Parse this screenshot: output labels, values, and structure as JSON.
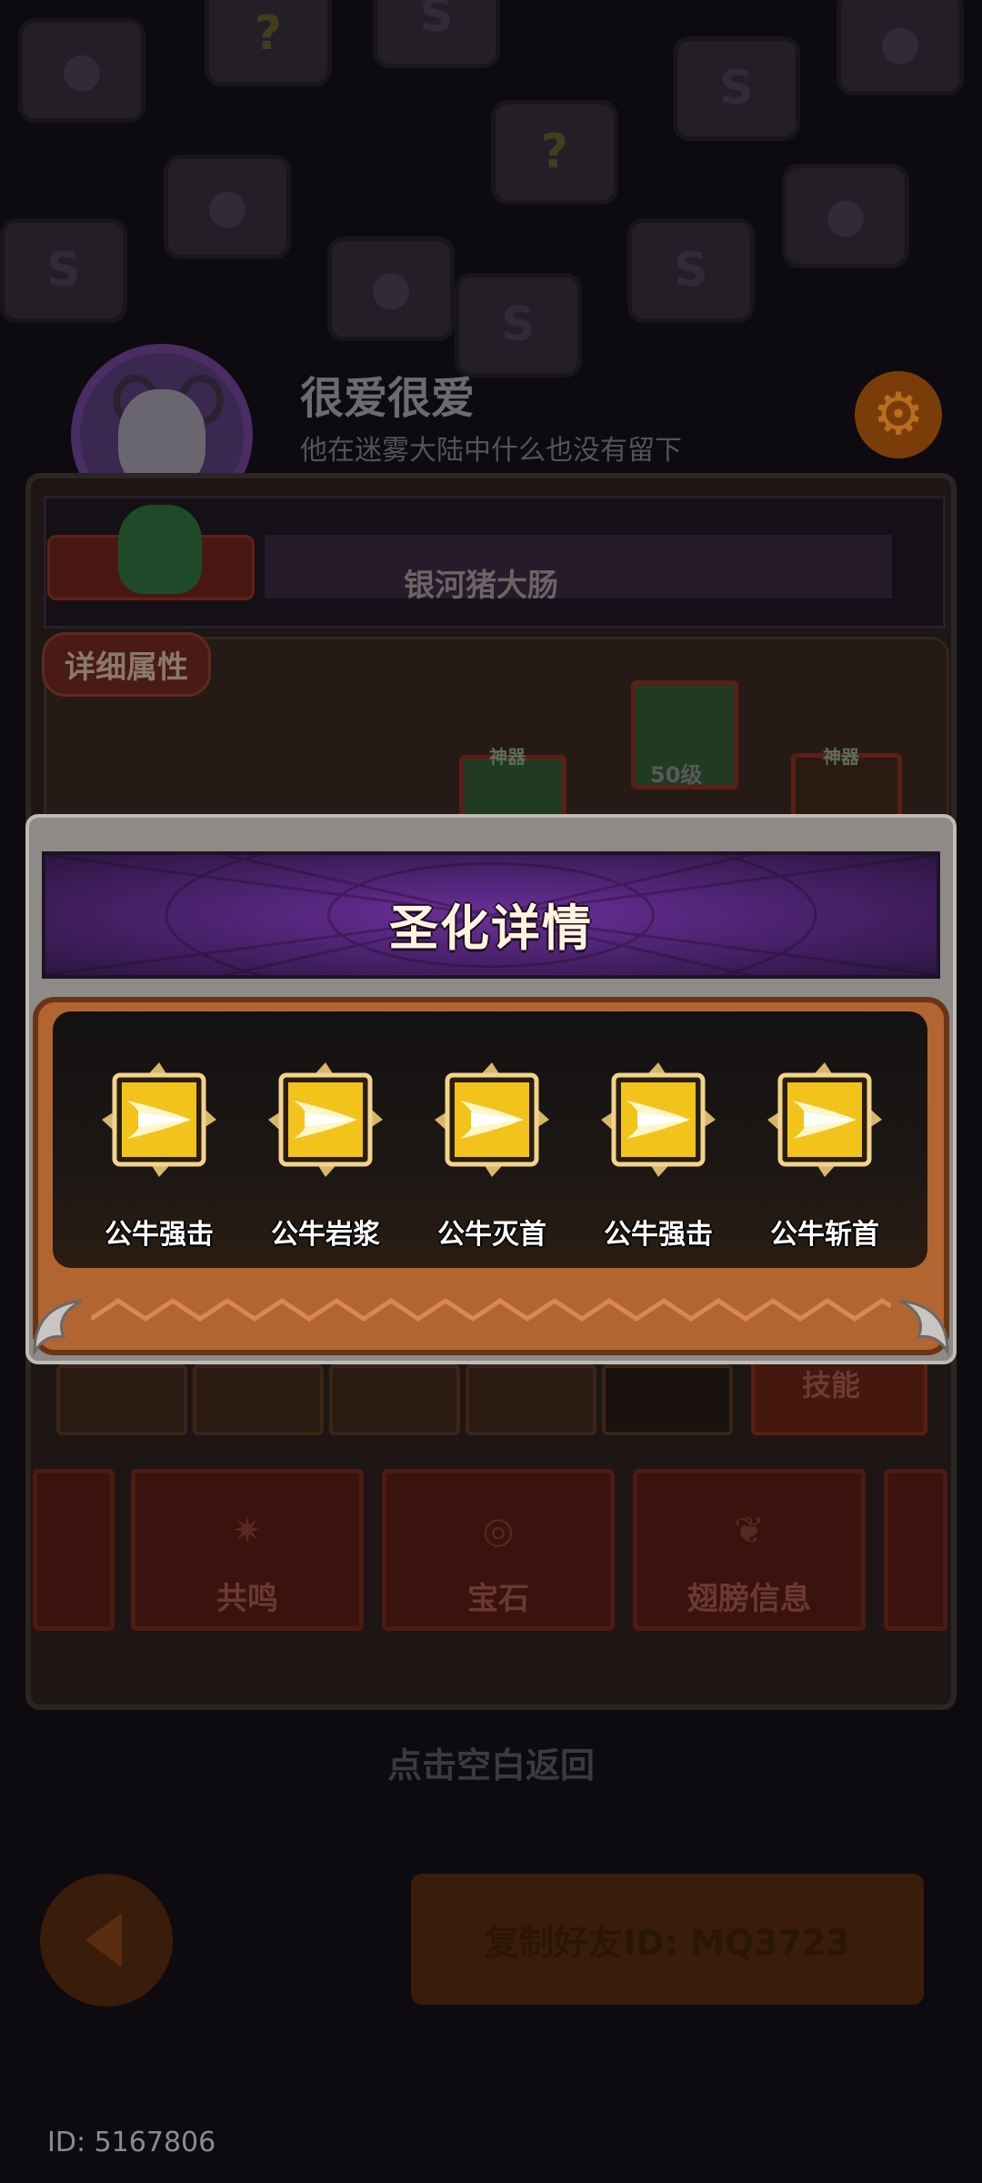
{
  "profile": {
    "name": "很爱很爱",
    "bio": "他在迷雾大陆中什么也没有留下"
  },
  "panel": {
    "title": "银河猪大肠",
    "attr_label": "详细属性",
    "slot_tag_1": "神器",
    "slot_tag_2": "神器",
    "slot_level": "50级",
    "skills_tab": "技能"
  },
  "menu": [
    {
      "label": "共鸣"
    },
    {
      "label": "宝石"
    },
    {
      "label": "翅膀信息"
    }
  ],
  "modal": {
    "title": "圣化详情",
    "skills": [
      {
        "name": "公牛强击"
      },
      {
        "name": "公牛岩浆"
      },
      {
        "name": "公牛灭首"
      },
      {
        "name": "公牛强击"
      },
      {
        "name": "公牛斩首"
      }
    ]
  },
  "footer": {
    "dismiss_hint": "点击空白返回",
    "copy_button": "复制好友ID: MQ3723",
    "user_id": "ID: 5167806"
  },
  "colors": {
    "modal_header": "#5a2a85",
    "modal_body": "#b26531",
    "icon_gold": "#f2c31a"
  }
}
